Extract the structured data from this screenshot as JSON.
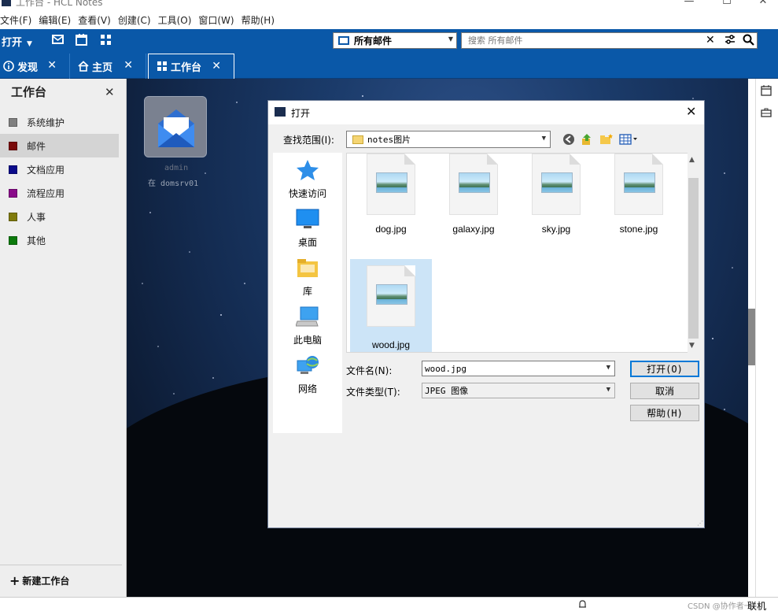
{
  "window": {
    "title": "工作台 - HCL Notes",
    "minimize": "—",
    "maximize": "☐",
    "close": "✕"
  },
  "menu": [
    "文件(F)",
    "编辑(E)",
    "查看(V)",
    "创建(C)",
    "工具(O)",
    "窗口(W)",
    "帮助(H)"
  ],
  "toolbar": {
    "open_label": "打开",
    "mail_scope": "所有邮件",
    "search_placeholder": "搜索 所有邮件"
  },
  "tabs": [
    {
      "label": "发现",
      "icon": "info-icon"
    },
    {
      "label": "主页",
      "icon": "home-icon"
    },
    {
      "label": "工作台",
      "icon": "grid-icon",
      "active": true
    }
  ],
  "sidebar": {
    "title": "工作台",
    "items": [
      {
        "label": "系统维护",
        "color": "#808080"
      },
      {
        "label": "邮件",
        "color": "#7a0b0b",
        "selected": true
      },
      {
        "label": "文档应用",
        "color": "#0b0b8a"
      },
      {
        "label": "流程应用",
        "color": "#8a0b8a"
      },
      {
        "label": "人事",
        "color": "#7f7a0b"
      },
      {
        "label": "其他",
        "color": "#0b7a0b"
      }
    ],
    "new_label": "新建工作台"
  },
  "workspace": {
    "db_label_line1": "admin",
    "db_label_line2": "在 domsrv01"
  },
  "dialog": {
    "title": "打开",
    "look_in_label": "查找范围(I):",
    "look_in_value": "notes图片",
    "places": [
      "快速访问",
      "桌面",
      "库",
      "此电脑",
      "网络"
    ],
    "files": [
      {
        "name": "dog.jpg"
      },
      {
        "name": "galaxy.jpg"
      },
      {
        "name": "sky.jpg"
      },
      {
        "name": "stone.jpg"
      },
      {
        "name": "wood.jpg",
        "selected": true
      }
    ],
    "filename_label": "文件名(N):",
    "filename_value": "wood.jpg",
    "filetype_label": "文件类型(T):",
    "filetype_value": "JPEG 图像",
    "open_button": "打开(O)",
    "cancel_button": "取消",
    "help_button": "帮助(H)"
  },
  "statusbar": {
    "watermark": "CSDN @协作者一",
    "online": "联机"
  },
  "colors": {
    "accent": "#0a58a8",
    "selection": "#cce4f7",
    "default_button_border": "#0078d7"
  }
}
